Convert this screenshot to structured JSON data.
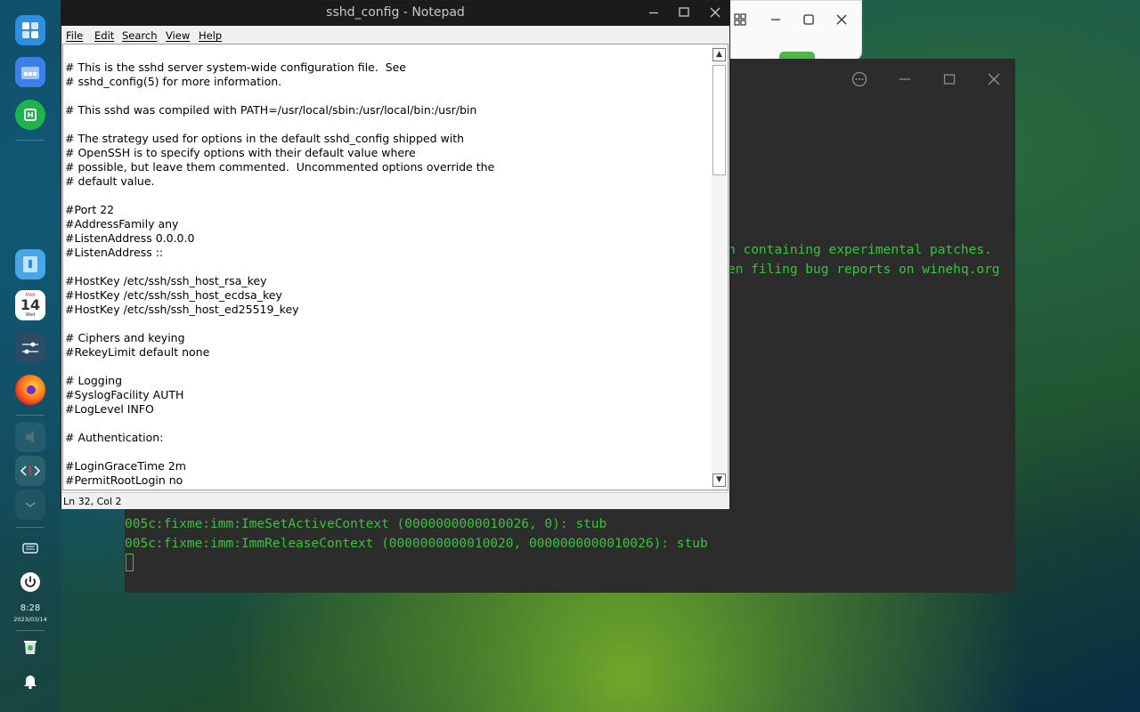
{
  "dock": {
    "icons": [
      "multitasking-view-icon",
      "file-manager-icon",
      "app-store-icon",
      "folder-icon",
      "calendar-icon",
      "control-center-icon",
      "firefox-icon",
      "media-icon",
      "code-icon",
      "chevron-down-icon",
      "keyboard-icon",
      "power-icon",
      "trash-icon",
      "notification-icon"
    ],
    "calendar_month": "MAR",
    "calendar_day": "14",
    "calendar_weekday": "Wed",
    "clock_time": "8:28",
    "clock_date": "2023/03/14"
  },
  "notepad": {
    "title": "sshd_config - Notepad",
    "menu": [
      "File",
      "Edit",
      "Search",
      "View",
      "Help"
    ],
    "status": "Ln 32, Col 2",
    "lines": [
      "# This is the sshd server system-wide configuration file.  See",
      "# sshd_config(5) for more information.",
      "",
      "# This sshd was compiled with PATH=/usr/local/sbin:/usr/local/bin:/usr/bin",
      "",
      "# The strategy used for options in the default sshd_config shipped with",
      "# OpenSSH is to specify options with their default value where",
      "# possible, but leave them commented.  Uncommented options override the",
      "# default value.",
      "",
      "#Port 22",
      "#AddressFamily any",
      "#ListenAddress 0.0.0.0",
      "#ListenAddress ::",
      "",
      "#HostKey /etc/ssh/ssh_host_rsa_key",
      "#HostKey /etc/ssh/ssh_host_ecdsa_key",
      "#HostKey /etc/ssh/ssh_host_ed25519_key",
      "",
      "# Ciphers and keying",
      "#RekeyLimit default none",
      "",
      "# Logging",
      "#SyslogFacility AUTH",
      "#LogLevel INFO",
      "",
      "# Authentication:",
      "",
      "#LoginGraceTime 2m",
      "#PermitRootLogin no"
    ]
  },
  "terminal": {
    "partial_line_1": "n containing experimental patches.",
    "partial_line_2": "en filing bug reports on winehq.org",
    "line_3": "005c:fixme:imm:ImeSetActiveContext (0000000000010026, 0): stub",
    "line_4": "005c:fixme:imm:ImmReleaseContext (0000000000010020, 0000000000010026): stub"
  },
  "colors": {
    "terminal_text": "#37c43a",
    "terminal_bg": "#2c2c2c",
    "notepad_title_bg": "#1b1b1b"
  }
}
